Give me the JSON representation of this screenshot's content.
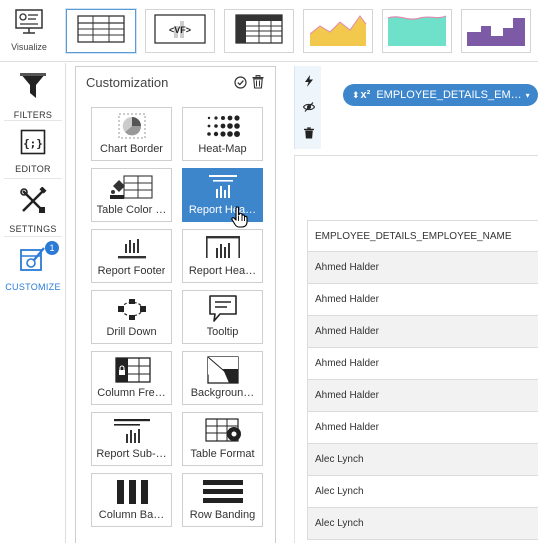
{
  "toolbar": {
    "visualize_label": "Visualize",
    "thumbnails": [
      {
        "name": "table-thumbnail-icon",
        "selected": true
      },
      {
        "name": "vf-thumbnail-icon",
        "text": "<VF>"
      },
      {
        "name": "grid-table-thumbnail-icon"
      },
      {
        "name": "area-chart-thumbnail-icon"
      },
      {
        "name": "teal-area-chart-thumbnail-icon"
      },
      {
        "name": "step-chart-thumbnail-icon"
      }
    ]
  },
  "sidebar": {
    "items": [
      {
        "label": "FILTERS",
        "icon": "funnel-icon"
      },
      {
        "label": "EDITOR",
        "icon": "code-braces-icon"
      },
      {
        "label": "SETTINGS",
        "icon": "tools-icon"
      },
      {
        "label": "CUSTOMIZE",
        "icon": "customize-icon",
        "active": true,
        "badge": "1"
      }
    ]
  },
  "panel": {
    "title": "Customization",
    "cards": [
      {
        "label": "Chart Border",
        "icon": "chart-border-icon"
      },
      {
        "label": "Heat-Map",
        "icon": "heat-map-icon"
      },
      {
        "label": "Table Color …",
        "icon": "table-color-icon"
      },
      {
        "label": "Report Hea…",
        "icon": "report-header-icon",
        "selected": true
      },
      {
        "label": "Report Footer",
        "icon": "report-footer-icon"
      },
      {
        "label": "Report Hea…",
        "icon": "report-header-2-icon"
      },
      {
        "label": "Drill Down",
        "icon": "drill-down-icon"
      },
      {
        "label": "Tooltip",
        "icon": "tooltip-icon"
      },
      {
        "label": "Column Fre…",
        "icon": "column-freeze-icon"
      },
      {
        "label": "Backgroun…",
        "icon": "background-icon"
      },
      {
        "label": "Report Sub-…",
        "icon": "report-subheader-icon"
      },
      {
        "label": "Table Format",
        "icon": "table-format-icon"
      },
      {
        "label": "Column Ba…",
        "icon": "column-banding-icon"
      },
      {
        "label": "Row Banding",
        "icon": "row-banding-icon"
      }
    ]
  },
  "field_pill": {
    "label": "EMPLOYEE_DETAILS_EM…"
  },
  "table": {
    "header": "EMPLOYEE_DETAILS_EMPLOYEE_NAME",
    "rows": [
      "Ahmed Halder",
      "Ahmed Halder",
      "Ahmed Halder",
      "Ahmed Halder",
      "Ahmed Halder",
      "Ahmed Halder",
      "Alec Lynch",
      "Alec Lynch",
      "Alec Lynch"
    ]
  },
  "colors": {
    "accent": "#3d86cc",
    "badge": "#2b7bd6",
    "area_yellow": "#f2c94c",
    "area_teal": "#6fe0c9",
    "step_purple": "#7d5aa6"
  }
}
